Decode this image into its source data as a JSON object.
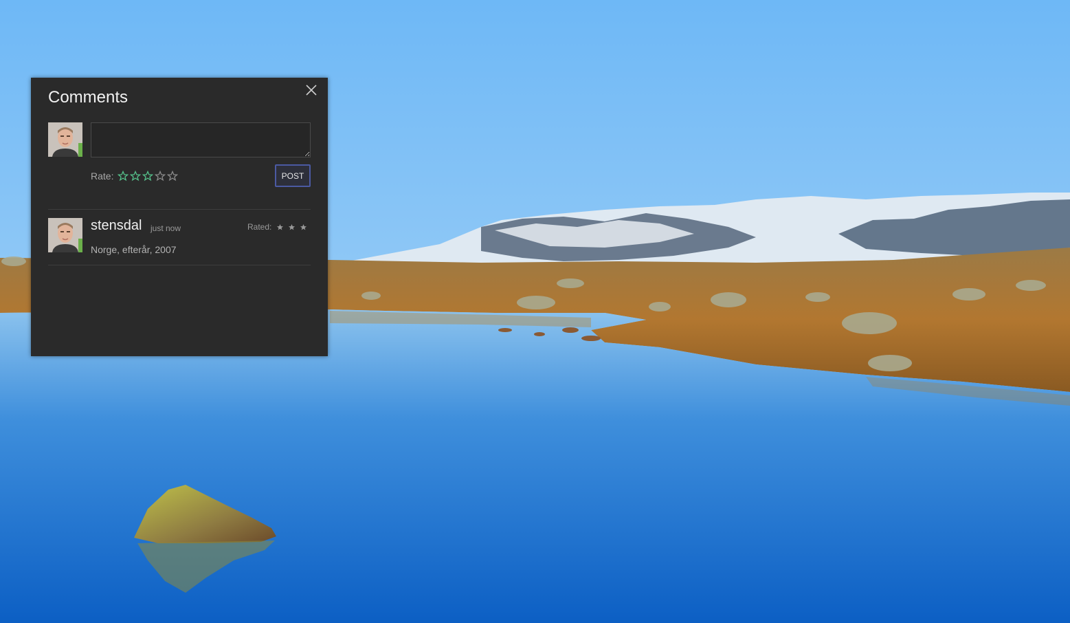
{
  "panel": {
    "title": "Comments",
    "close_icon": "close-icon"
  },
  "composer": {
    "input_value": "",
    "input_placeholder": "",
    "rate_label": "Rate:",
    "rating": 3,
    "max_rating": 5,
    "post_label": "POST"
  },
  "comments": [
    {
      "user": "stensdal",
      "time": "just now",
      "rated_label": "Rated:",
      "rating": 3,
      "text": "Norge, efterår, 2007"
    }
  ],
  "colors": {
    "panel_bg": "#2a2a2a",
    "star_active": "#55c08a",
    "star_inactive": "#8a8a8a",
    "post_border": "#4b5aa3"
  }
}
